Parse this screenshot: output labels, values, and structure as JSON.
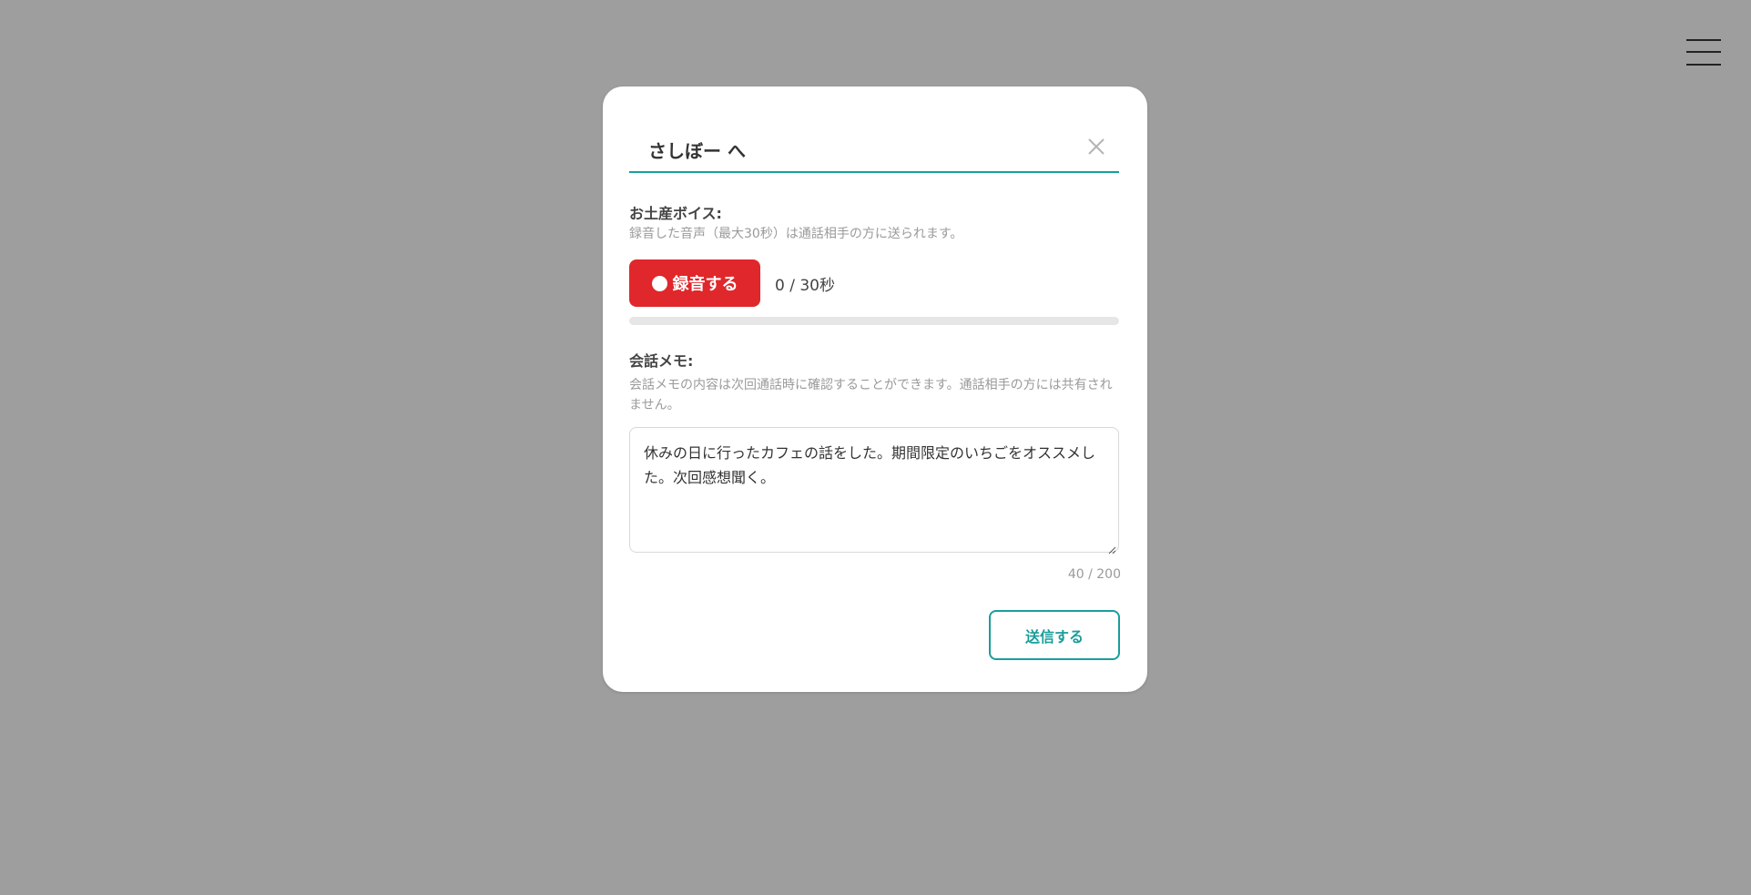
{
  "modal": {
    "recipient": "さしぼー へ",
    "voice": {
      "label": "お土産ボイス:",
      "description": "録音した音声（最大30秒）は通話相手の方に送られます。",
      "record_label": "録音する",
      "time_readout": "0 / 30秒",
      "progress": 0
    },
    "memo": {
      "label": "会話メモ:",
      "description": "会話メモの内容は次回通話時に確認することができます。通話相手の方には共有されません。",
      "value": "休みの日に行ったカフェの話をした。期間限定のいちごをオススメした。次回感想聞く。",
      "char_count": "40 / 200"
    },
    "submit_label": "送信する"
  },
  "colors": {
    "accent": "#1a9e9b",
    "record": "#e0272b",
    "overlay": "#9e9e9e"
  },
  "icons": {
    "menu": "hamburger-menu-icon",
    "close": "close-icon",
    "record": "record-dot-icon"
  }
}
